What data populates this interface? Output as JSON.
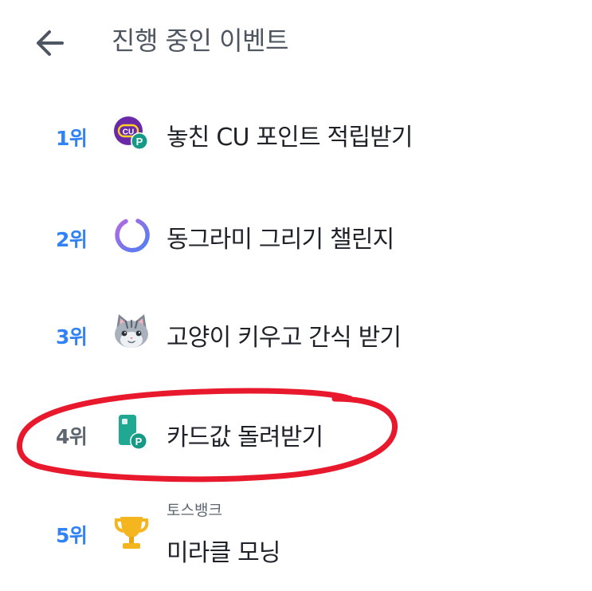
{
  "header": {
    "back_icon": "arrow-left-icon",
    "title": "진행 중인 이벤트"
  },
  "events": [
    {
      "rank": "1위",
      "icon": "cu-point-icon",
      "title": "놓친 CU 포인트 적립받기"
    },
    {
      "rank": "2위",
      "icon": "circle-challenge-icon",
      "title": "동그라미 그리기 챌린지"
    },
    {
      "rank": "3위",
      "icon": "cat-face-icon",
      "title": "고양이 키우고 간식 받기"
    },
    {
      "rank": "4위",
      "icon": "card-point-icon",
      "title": "카드값 돌려받기"
    },
    {
      "rank": "5위",
      "icon": "trophy-icon",
      "subtitle": "토스뱅크",
      "title": "미라클 모닝"
    }
  ],
  "colors": {
    "rank_highlight": "#3182f6",
    "rank_muted": "#5e6670",
    "annotation_red": "#e8192c",
    "cu_purple": "#6a2aa8",
    "point_green": "#169a86",
    "card_teal": "#1fa892",
    "trophy_gold": "#f5b51f"
  }
}
